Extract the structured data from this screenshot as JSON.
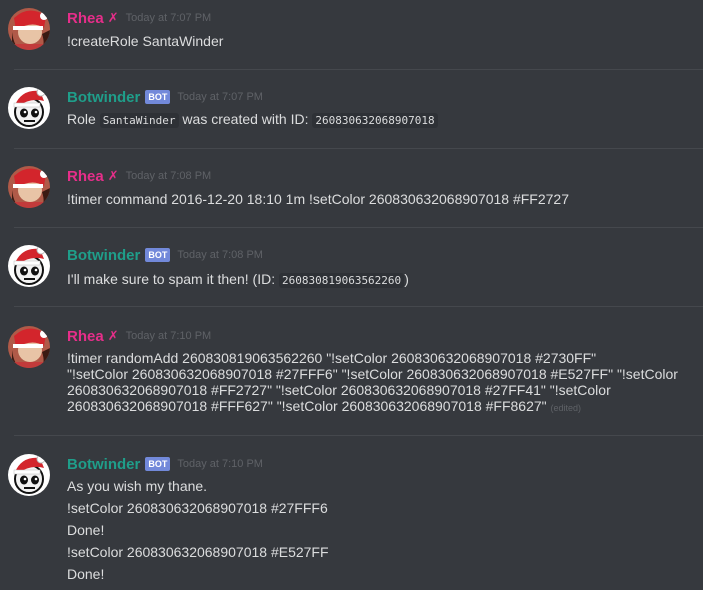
{
  "colors": {
    "background": "#36393e",
    "rhea": "#e62e8a",
    "bot": "#1f9e8a",
    "badge": "#7289da"
  },
  "messages": [
    {
      "author": "Rhea",
      "timestamp": "Today at 7:07 PM",
      "lines": [
        "!createRole SantaWinder"
      ]
    },
    {
      "author": "Botwinder",
      "badge": "BOT",
      "timestamp": "Today at 7:07 PM",
      "line_parts": {
        "a": "Role ",
        "code1": "SantaWinder",
        "b": " was created with ID: ",
        "code2": "260830632068907018"
      }
    },
    {
      "author": "Rhea",
      "timestamp": "Today at 7:08 PM",
      "lines": [
        "!timer command 2016-12-20 18:10 1m !setColor 260830632068907018 #FF2727"
      ]
    },
    {
      "author": "Botwinder",
      "badge": "BOT",
      "timestamp": "Today at 7:08 PM",
      "line_parts": {
        "a": "I'll make sure to spam it then! (ID: ",
        "code1": "260830819063562260",
        "b": ")"
      }
    },
    {
      "author": "Rhea",
      "timestamp": "Today at 7:10 PM",
      "lines": [
        "!timer randomAdd 260830819063562260 \"!setColor 260830632068907018 #2730FF\"",
        "\"!setColor 260830632068907018 #27FFF6\" \"!setColor 260830632068907018 #E527FF\" \"!setColor",
        "260830632068907018 #FF2727\" \"!setColor 260830632068907018 #27FF41\" \"!setColor",
        "260830632068907018 #FFF627\" \"!setColor 260830632068907018 #FF8627\""
      ],
      "edited": "(edited)"
    },
    {
      "author": "Botwinder",
      "badge": "BOT",
      "timestamp": "Today at 7:10 PM",
      "lines": [
        "As you wish my thane.",
        "!setColor 260830632068907018 #27FFF6",
        "Done!",
        "!setColor 260830632068907018 #E527FF",
        "Done!"
      ]
    }
  ]
}
